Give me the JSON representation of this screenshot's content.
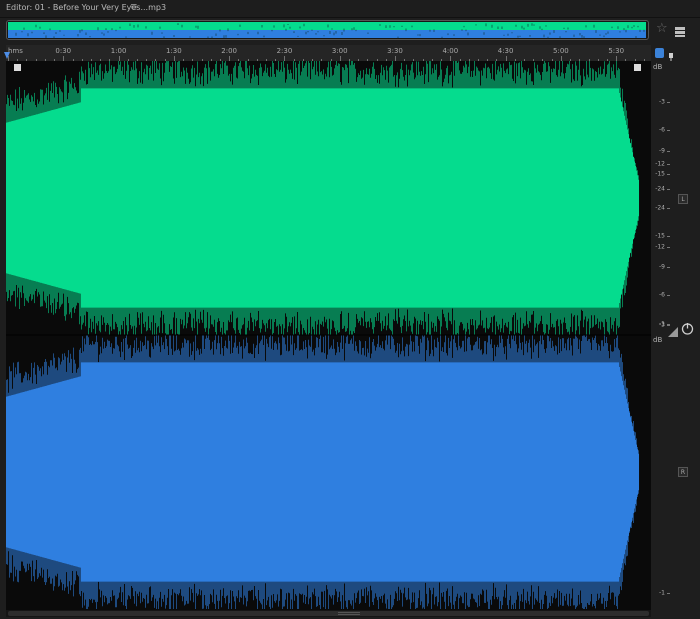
{
  "editor": {
    "title": "Editor: 01 - Before Your Very Eyes...mp3",
    "menu_icon": "hamburger-menu-icon"
  },
  "overview": {
    "colors": {
      "left": "#05dc8e",
      "right": "#2f7fe0",
      "frame": "#555555"
    }
  },
  "toolbar_icons": [
    "star-icon",
    "list-icon",
    "headphone-icon",
    "marker-icon",
    "level-icon",
    "power-icon"
  ],
  "timeline": {
    "unit_label": "hms",
    "ticks": [
      {
        "label": "0:30",
        "seconds": 30
      },
      {
        "label": "1:00",
        "seconds": 60
      },
      {
        "label": "1:30",
        "seconds": 90
      },
      {
        "label": "2:00",
        "seconds": 120
      },
      {
        "label": "2:30",
        "seconds": 150
      },
      {
        "label": "3:00",
        "seconds": 180
      },
      {
        "label": "3:30",
        "seconds": 210
      },
      {
        "label": "4:00",
        "seconds": 240
      },
      {
        "label": "4:30",
        "seconds": 270
      },
      {
        "label": "5:00",
        "seconds": 300
      },
      {
        "label": "5:30",
        "seconds": 330
      }
    ],
    "playhead_seconds": 0
  },
  "channels": [
    {
      "id": "L",
      "badge": "L",
      "color": "#05dc8e"
    },
    {
      "id": "R",
      "badge": "R",
      "color": "#2f7fe0"
    }
  ],
  "db_scale": {
    "unit": "dB",
    "labels": [
      "-1",
      "-3",
      "-6",
      "-9",
      "-12",
      "-15",
      "-24",
      "-24",
      "-15",
      "-12",
      "-9",
      "-6",
      "-3",
      "-1"
    ]
  },
  "colors": {
    "background": "#1e1e1e",
    "wave_background": "#0a0a0a",
    "accent": "#3b82d8"
  }
}
